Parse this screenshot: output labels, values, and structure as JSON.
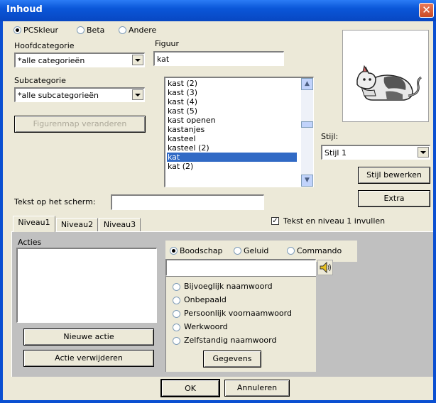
{
  "window": {
    "title": "Inhoud",
    "close": "✕"
  },
  "sources": {
    "options": [
      "PCSkleur",
      "Beta",
      "Andere"
    ],
    "selected": 0
  },
  "hoofdcategorie": {
    "label": "Hoofdcategorie",
    "value": "*alle categorieën"
  },
  "subcategorie": {
    "label": "Subcategorie",
    "value": "*alle subcategorieën"
  },
  "figuur": {
    "label": "Figuur",
    "value": "kat"
  },
  "figure_list": {
    "items": [
      "kast (2)",
      "kast (3)",
      "kast (4)",
      "kast (5)",
      "kast openen",
      "kastanjes",
      "kasteel",
      "kasteel (2)",
      "kat",
      "kat (2)"
    ],
    "selected": 8
  },
  "buttons": {
    "figurenmap": "Figurenmap veranderen",
    "stijl_bewerken": "Stijl bewerken",
    "extra": "Extra",
    "nieuwe_actie": "Nieuwe actie",
    "actie_verwijderen": "Actie verwijderen",
    "gegevens": "Gegevens",
    "ok": "OK",
    "annuleren": "Annuleren"
  },
  "stijl": {
    "label": "Stijl:",
    "value": "Stijl 1"
  },
  "tekst_scherm": {
    "label": "Tekst op het scherm:",
    "value": ""
  },
  "tekst_niveau": {
    "label": "Tekst en niveau 1 invullen",
    "checked": true,
    "mark": "✓"
  },
  "tabs": [
    "Niveau1",
    "Niveau2",
    "Niveau3"
  ],
  "acties": {
    "label": "Acties"
  },
  "action_type": {
    "options": [
      "Boodschap",
      "Geluid",
      "Commando"
    ],
    "selected": 0
  },
  "message": {
    "value": ""
  },
  "word_types": [
    "Bijvoeglijk naamwoord",
    "Onbepaald",
    "Persoonlijk voornaamwoord",
    "Werkwoord",
    "Zelfstandig naamwoord"
  ]
}
